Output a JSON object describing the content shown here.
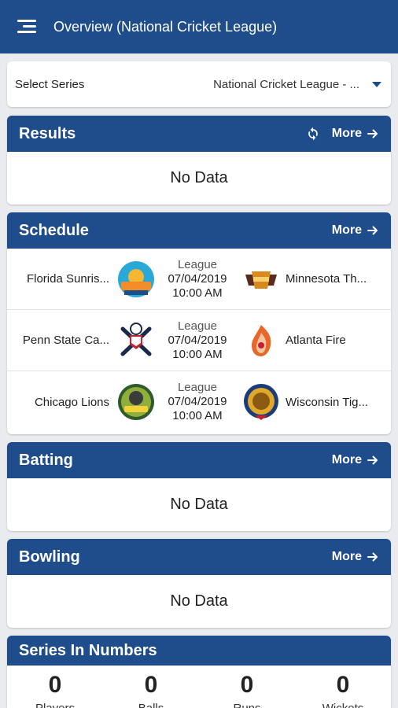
{
  "appbar": {
    "title": "Overview (National Cricket League)"
  },
  "select_series": {
    "label": "Select Series",
    "value": "National Cricket League - ..."
  },
  "results": {
    "title": "Results",
    "more": "More",
    "empty": "No Data"
  },
  "schedule": {
    "title": "Schedule",
    "more": "More",
    "matches": [
      {
        "home": "Florida Sunris...",
        "away": "Minnesota Th...",
        "type": "League",
        "date": "07/04/2019",
        "time": "10:00 AM"
      },
      {
        "home": "Penn State Ca...",
        "away": "Atlanta Fire",
        "type": "League",
        "date": "07/04/2019",
        "time": "10:00 AM"
      },
      {
        "home": "Chicago Lions",
        "away": "Wisconsin Tig...",
        "type": "League",
        "date": "07/04/2019",
        "time": "10:00 AM"
      }
    ]
  },
  "batting": {
    "title": "Batting",
    "more": "More",
    "empty": "No Data"
  },
  "bowling": {
    "title": "Bowling",
    "more": "More",
    "empty": "No Data"
  },
  "series_numbers": {
    "title": "Series In Numbers",
    "stats": [
      {
        "value": "0",
        "label": "Players"
      },
      {
        "value": "0",
        "label": "Balls"
      },
      {
        "value": "0",
        "label": "Runs"
      },
      {
        "value": "0",
        "label": "Wickets"
      }
    ]
  },
  "colors": {
    "primary": "#1f4d8c",
    "background": "#e9ebee"
  }
}
